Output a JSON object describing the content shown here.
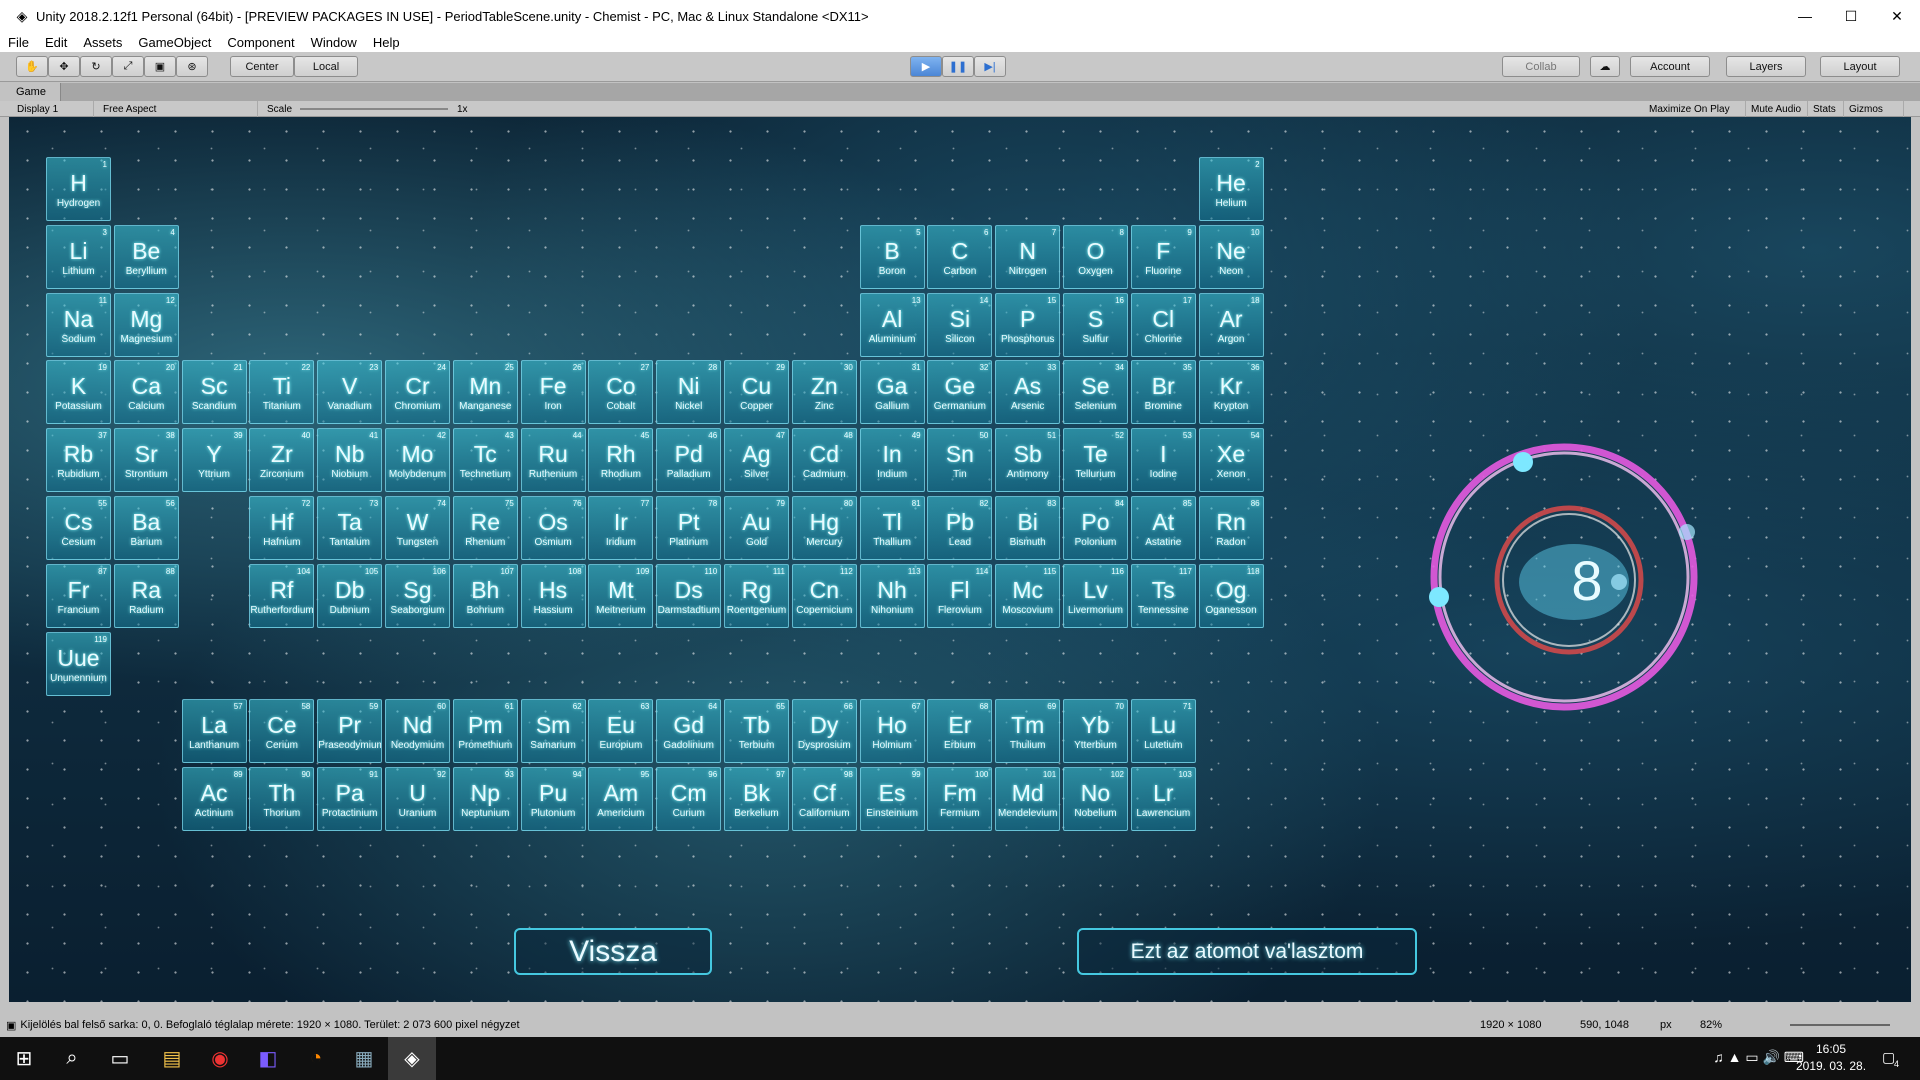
{
  "window": {
    "title": "Unity 2018.2.12f1 Personal (64bit) - [PREVIEW PACKAGES IN USE] - PeriodTableScene.unity - Chemist - PC, Mac & Linux Standalone <DX11>",
    "minimize": "—",
    "maximize": "☐",
    "close": "✕"
  },
  "menu": [
    "File",
    "Edit",
    "Assets",
    "GameObject",
    "Component",
    "Window",
    "Help"
  ],
  "toolbar": {
    "center": "Center",
    "local": "Local",
    "collab": "Collab",
    "account": "Account",
    "layers": "Layers",
    "layout": "Layout",
    "play": "▶",
    "pause": "❚❚",
    "step": "▶|"
  },
  "game_tab": {
    "label": "Game",
    "display": "Display 1",
    "aspect": "Free Aspect",
    "scale_label": "Scale",
    "scale_value": "1x",
    "maximize": "Maximize On Play",
    "mute": "Mute Audio",
    "stats": "Stats",
    "gizmos": "Gizmos"
  },
  "elements": [
    {
      "s": "H",
      "n": "Hydrogen",
      "z": "1",
      "r": 0,
      "c": 0
    },
    {
      "s": "He",
      "n": "Helium",
      "z": "2",
      "r": 0,
      "c": 17
    },
    {
      "s": "Li",
      "n": "Lithium",
      "z": "3",
      "r": 1,
      "c": 0
    },
    {
      "s": "Be",
      "n": "Beryllium",
      "z": "4",
      "r": 1,
      "c": 1
    },
    {
      "s": "B",
      "n": "Boron",
      "z": "5",
      "r": 1,
      "c": 12
    },
    {
      "s": "C",
      "n": "Carbon",
      "z": "6",
      "r": 1,
      "c": 13
    },
    {
      "s": "N",
      "n": "Nitrogen",
      "z": "7",
      "r": 1,
      "c": 14
    },
    {
      "s": "O",
      "n": "Oxygen",
      "z": "8",
      "r": 1,
      "c": 15
    },
    {
      "s": "F",
      "n": "Fluorine",
      "z": "9",
      "r": 1,
      "c": 16
    },
    {
      "s": "Ne",
      "n": "Neon",
      "z": "10",
      "r": 1,
      "c": 17
    },
    {
      "s": "Na",
      "n": "Sodium",
      "z": "11",
      "r": 2,
      "c": 0
    },
    {
      "s": "Mg",
      "n": "Magnesium",
      "z": "12",
      "r": 2,
      "c": 1
    },
    {
      "s": "Al",
      "n": "Aluminium",
      "z": "13",
      "r": 2,
      "c": 12
    },
    {
      "s": "Si",
      "n": "Silicon",
      "z": "14",
      "r": 2,
      "c": 13
    },
    {
      "s": "P",
      "n": "Phosphorus",
      "z": "15",
      "r": 2,
      "c": 14
    },
    {
      "s": "S",
      "n": "Sulfur",
      "z": "16",
      "r": 2,
      "c": 15
    },
    {
      "s": "Cl",
      "n": "Chlorine",
      "z": "17",
      "r": 2,
      "c": 16
    },
    {
      "s": "Ar",
      "n": "Argon",
      "z": "18",
      "r": 2,
      "c": 17
    },
    {
      "s": "K",
      "n": "Potassium",
      "z": "19",
      "r": 3,
      "c": 0
    },
    {
      "s": "Ca",
      "n": "Calcium",
      "z": "20",
      "r": 3,
      "c": 1
    },
    {
      "s": "Sc",
      "n": "Scandium",
      "z": "21",
      "r": 3,
      "c": 2
    },
    {
      "s": "Ti",
      "n": "Titanium",
      "z": "22",
      "r": 3,
      "c": 3
    },
    {
      "s": "V",
      "n": "Vanadium",
      "z": "23",
      "r": 3,
      "c": 4
    },
    {
      "s": "Cr",
      "n": "Chromium",
      "z": "24",
      "r": 3,
      "c": 5
    },
    {
      "s": "Mn",
      "n": "Manganese",
      "z": "25",
      "r": 3,
      "c": 6
    },
    {
      "s": "Fe",
      "n": "Iron",
      "z": "26",
      "r": 3,
      "c": 7
    },
    {
      "s": "Co",
      "n": "Cobalt",
      "z": "27",
      "r": 3,
      "c": 8
    },
    {
      "s": "Ni",
      "n": "Nickel",
      "z": "28",
      "r": 3,
      "c": 9
    },
    {
      "s": "Cu",
      "n": "Copper",
      "z": "29",
      "r": 3,
      "c": 10
    },
    {
      "s": "Zn",
      "n": "Zinc",
      "z": "30",
      "r": 3,
      "c": 11
    },
    {
      "s": "Ga",
      "n": "Gallium",
      "z": "31",
      "r": 3,
      "c": 12
    },
    {
      "s": "Ge",
      "n": "Germanium",
      "z": "32",
      "r": 3,
      "c": 13
    },
    {
      "s": "As",
      "n": "Arsenic",
      "z": "33",
      "r": 3,
      "c": 14
    },
    {
      "s": "Se",
      "n": "Selenium",
      "z": "34",
      "r": 3,
      "c": 15
    },
    {
      "s": "Br",
      "n": "Bromine",
      "z": "35",
      "r": 3,
      "c": 16
    },
    {
      "s": "Kr",
      "n": "Krypton",
      "z": "36",
      "r": 3,
      "c": 17
    },
    {
      "s": "Rb",
      "n": "Rubidium",
      "z": "37",
      "r": 4,
      "c": 0
    },
    {
      "s": "Sr",
      "n": "Strontium",
      "z": "38",
      "r": 4,
      "c": 1
    },
    {
      "s": "Y",
      "n": "Yttrium",
      "z": "39",
      "r": 4,
      "c": 2
    },
    {
      "s": "Zr",
      "n": "Zirconium",
      "z": "40",
      "r": 4,
      "c": 3
    },
    {
      "s": "Nb",
      "n": "Niobium",
      "z": "41",
      "r": 4,
      "c": 4
    },
    {
      "s": "Mo",
      "n": "Molybdenum",
      "z": "42",
      "r": 4,
      "c": 5
    },
    {
      "s": "Tc",
      "n": "Technetium",
      "z": "43",
      "r": 4,
      "c": 6
    },
    {
      "s": "Ru",
      "n": "Ruthenium",
      "z": "44",
      "r": 4,
      "c": 7
    },
    {
      "s": "Rh",
      "n": "Rhodium",
      "z": "45",
      "r": 4,
      "c": 8
    },
    {
      "s": "Pd",
      "n": "Palladium",
      "z": "46",
      "r": 4,
      "c": 9
    },
    {
      "s": "Ag",
      "n": "Silver",
      "z": "47",
      "r": 4,
      "c": 10
    },
    {
      "s": "Cd",
      "n": "Cadmium",
      "z": "48",
      "r": 4,
      "c": 11
    },
    {
      "s": "In",
      "n": "Indium",
      "z": "49",
      "r": 4,
      "c": 12
    },
    {
      "s": "Sn",
      "n": "Tin",
      "z": "50",
      "r": 4,
      "c": 13
    },
    {
      "s": "Sb",
      "n": "Antimony",
      "z": "51",
      "r": 4,
      "c": 14
    },
    {
      "s": "Te",
      "n": "Tellurium",
      "z": "52",
      "r": 4,
      "c": 15
    },
    {
      "s": "I",
      "n": "Iodine",
      "z": "53",
      "r": 4,
      "c": 16
    },
    {
      "s": "Xe",
      "n": "Xenon",
      "z": "54",
      "r": 4,
      "c": 17
    },
    {
      "s": "Cs",
      "n": "Cesium",
      "z": "55",
      "r": 5,
      "c": 0
    },
    {
      "s": "Ba",
      "n": "Barium",
      "z": "56",
      "r": 5,
      "c": 1
    },
    {
      "s": "Hf",
      "n": "Hafnium",
      "z": "72",
      "r": 5,
      "c": 3
    },
    {
      "s": "Ta",
      "n": "Tantalum",
      "z": "73",
      "r": 5,
      "c": 4
    },
    {
      "s": "W",
      "n": "Tungsten",
      "z": "74",
      "r": 5,
      "c": 5
    },
    {
      "s": "Re",
      "n": "Rhenium",
      "z": "75",
      "r": 5,
      "c": 6
    },
    {
      "s": "Os",
      "n": "Osmium",
      "z": "76",
      "r": 5,
      "c": 7
    },
    {
      "s": "Ir",
      "n": "Iridium",
      "z": "77",
      "r": 5,
      "c": 8
    },
    {
      "s": "Pt",
      "n": "Platinum",
      "z": "78",
      "r": 5,
      "c": 9
    },
    {
      "s": "Au",
      "n": "Gold",
      "z": "79",
      "r": 5,
      "c": 10
    },
    {
      "s": "Hg",
      "n": "Mercury",
      "z": "80",
      "r": 5,
      "c": 11
    },
    {
      "s": "Tl",
      "n": "Thallium",
      "z": "81",
      "r": 5,
      "c": 12
    },
    {
      "s": "Pb",
      "n": "Lead",
      "z": "82",
      "r": 5,
      "c": 13
    },
    {
      "s": "Bi",
      "n": "Bismuth",
      "z": "83",
      "r": 5,
      "c": 14
    },
    {
      "s": "Po",
      "n": "Polonium",
      "z": "84",
      "r": 5,
      "c": 15
    },
    {
      "s": "At",
      "n": "Astatine",
      "z": "85",
      "r": 5,
      "c": 16
    },
    {
      "s": "Rn",
      "n": "Radon",
      "z": "86",
      "r": 5,
      "c": 17
    },
    {
      "s": "Fr",
      "n": "Francium",
      "z": "87",
      "r": 6,
      "c": 0
    },
    {
      "s": "Ra",
      "n": "Radium",
      "z": "88",
      "r": 6,
      "c": 1
    },
    {
      "s": "Rf",
      "n": "Rutherfordium",
      "z": "104",
      "r": 6,
      "c": 3
    },
    {
      "s": "Db",
      "n": "Dubnium",
      "z": "105",
      "r": 6,
      "c": 4
    },
    {
      "s": "Sg",
      "n": "Seaborgium",
      "z": "106",
      "r": 6,
      "c": 5
    },
    {
      "s": "Bh",
      "n": "Bohrium",
      "z": "107",
      "r": 6,
      "c": 6
    },
    {
      "s": "Hs",
      "n": "Hassium",
      "z": "108",
      "r": 6,
      "c": 7
    },
    {
      "s": "Mt",
      "n": "Meitnerium",
      "z": "109",
      "r": 6,
      "c": 8
    },
    {
      "s": "Ds",
      "n": "Darmstadtium",
      "z": "110",
      "r": 6,
      "c": 9
    },
    {
      "s": "Rg",
      "n": "Roentgenium",
      "z": "111",
      "r": 6,
      "c": 10
    },
    {
      "s": "Cn",
      "n": "Copernicium",
      "z": "112",
      "r": 6,
      "c": 11
    },
    {
      "s": "Nh",
      "n": "Nihonium",
      "z": "113",
      "r": 6,
      "c": 12
    },
    {
      "s": "Fl",
      "n": "Flerovium",
      "z": "114",
      "r": 6,
      "c": 13
    },
    {
      "s": "Mc",
      "n": "Moscovium",
      "z": "115",
      "r": 6,
      "c": 14
    },
    {
      "s": "Lv",
      "n": "Livermorium",
      "z": "116",
      "r": 6,
      "c": 15
    },
    {
      "s": "Ts",
      "n": "Tennessine",
      "z": "117",
      "r": 6,
      "c": 16
    },
    {
      "s": "Og",
      "n": "Oganesson",
      "z": "118",
      "r": 6,
      "c": 17
    },
    {
      "s": "Uue",
      "n": "Ununennium",
      "z": "119",
      "r": 7,
      "c": 0
    },
    {
      "s": "La",
      "n": "Lanthanum",
      "z": "57",
      "r": 8,
      "c": 2
    },
    {
      "s": "Ce",
      "n": "Cerium",
      "z": "58",
      "r": 8,
      "c": 3
    },
    {
      "s": "Pr",
      "n": "Praseodymium",
      "z": "59",
      "r": 8,
      "c": 4
    },
    {
      "s": "Nd",
      "n": "Neodymium",
      "z": "60",
      "r": 8,
      "c": 5
    },
    {
      "s": "Pm",
      "n": "Promethium",
      "z": "61",
      "r": 8,
      "c": 6
    },
    {
      "s": "Sm",
      "n": "Samarium",
      "z": "62",
      "r": 8,
      "c": 7
    },
    {
      "s": "Eu",
      "n": "Europium",
      "z": "63",
      "r": 8,
      "c": 8
    },
    {
      "s": "Gd",
      "n": "Gadolinium",
      "z": "64",
      "r": 8,
      "c": 9
    },
    {
      "s": "Tb",
      "n": "Terbium",
      "z": "65",
      "r": 8,
      "c": 10
    },
    {
      "s": "Dy",
      "n": "Dysprosium",
      "z": "66",
      "r": 8,
      "c": 11
    },
    {
      "s": "Ho",
      "n": "Holmium",
      "z": "67",
      "r": 8,
      "c": 12
    },
    {
      "s": "Er",
      "n": "Erbium",
      "z": "68",
      "r": 8,
      "c": 13
    },
    {
      "s": "Tm",
      "n": "Thulium",
      "z": "69",
      "r": 8,
      "c": 14
    },
    {
      "s": "Yb",
      "n": "Ytterbium",
      "z": "70",
      "r": 8,
      "c": 15
    },
    {
      "s": "Lu",
      "n": "Lutetium",
      "z": "71",
      "r": 8,
      "c": 16
    },
    {
      "s": "Ac",
      "n": "Actinium",
      "z": "89",
      "r": 9,
      "c": 2
    },
    {
      "s": "Th",
      "n": "Thorium",
      "z": "90",
      "r": 9,
      "c": 3
    },
    {
      "s": "Pa",
      "n": "Protactinium",
      "z": "91",
      "r": 9,
      "c": 4
    },
    {
      "s": "U",
      "n": "Uranium",
      "z": "92",
      "r": 9,
      "c": 5
    },
    {
      "s": "Np",
      "n": "Neptunium",
      "z": "93",
      "r": 9,
      "c": 6
    },
    {
      "s": "Pu",
      "n": "Plutonium",
      "z": "94",
      "r": 9,
      "c": 7
    },
    {
      "s": "Am",
      "n": "Americium",
      "z": "95",
      "r": 9,
      "c": 8
    },
    {
      "s": "Cm",
      "n": "Curium",
      "z": "96",
      "r": 9,
      "c": 9
    },
    {
      "s": "Bk",
      "n": "Berkelium",
      "z": "97",
      "r": 9,
      "c": 10
    },
    {
      "s": "Cf",
      "n": "Californium",
      "z": "98",
      "r": 9,
      "c": 11
    },
    {
      "s": "Es",
      "n": "Einsteinium",
      "z": "99",
      "r": 9,
      "c": 12
    },
    {
      "s": "Fm",
      "n": "Fermium",
      "z": "100",
      "r": 9,
      "c": 13
    },
    {
      "s": "Md",
      "n": "Mendelevium",
      "z": "101",
      "r": 9,
      "c": 14
    },
    {
      "s": "No",
      "n": "Nobelium",
      "z": "102",
      "r": 9,
      "c": 15
    },
    {
      "s": "Lr",
      "n": "Lawrencium",
      "z": "103",
      "r": 9,
      "c": 16
    }
  ],
  "atom": {
    "number": "8"
  },
  "buttons": {
    "back": "Vissza",
    "choose": "Ezt az atomot va'lasztom"
  },
  "status": {
    "text": "Kijelölés bal felső sarka: 0, 0. Befoglaló téglalap mérete: 1920 × 1080. Terület: 2 073 600 pixel négyzet",
    "size": "1920 × 1080",
    "coords": "590, 1048",
    "unit": "px",
    "zoom": "82%"
  },
  "taskbar": {
    "time": "16:05",
    "date": "2019. 03. 28.",
    "notif": "4"
  }
}
